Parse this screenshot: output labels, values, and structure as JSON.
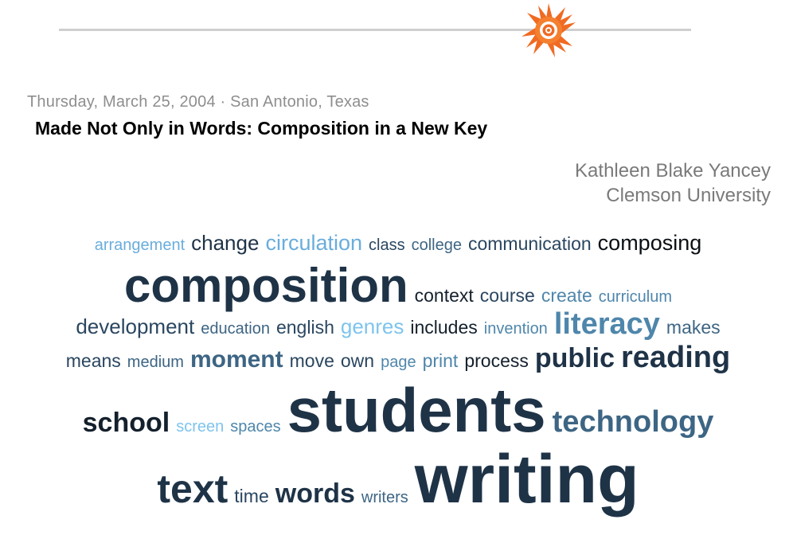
{
  "header": {
    "logo_icon": "orange-sun-logo",
    "rule_color": "#cfcfcf"
  },
  "dateline": "Thursday, March 25, 2004 · San Antonio, Texas",
  "title": "Made Not Only in Words: Composition in a New Key",
  "speaker": {
    "name": "Kathleen Blake Yancey",
    "affiliation": "Clemson University"
  },
  "tag_cloud": {
    "colors": {
      "lightest": "#7ec4ee",
      "light": "#6aaddc",
      "mid": "#4f86ab",
      "dark": "#2a4660",
      "darkest": "#0a0f14"
    },
    "words": [
      "arrangement",
      "change",
      "circulation",
      "class",
      "college",
      "communication",
      "composing",
      "composition",
      "context",
      "course",
      "create",
      "curriculum",
      "development",
      "education",
      "english",
      "genres",
      "includes",
      "invention",
      "literacy",
      "makes",
      "means",
      "medium",
      "moment",
      "move",
      "own",
      "page",
      "print",
      "process",
      "public",
      "reading",
      "school",
      "screen",
      "spaces",
      "students",
      "technology",
      "text",
      "time",
      "words",
      "writers",
      "writing"
    ]
  }
}
